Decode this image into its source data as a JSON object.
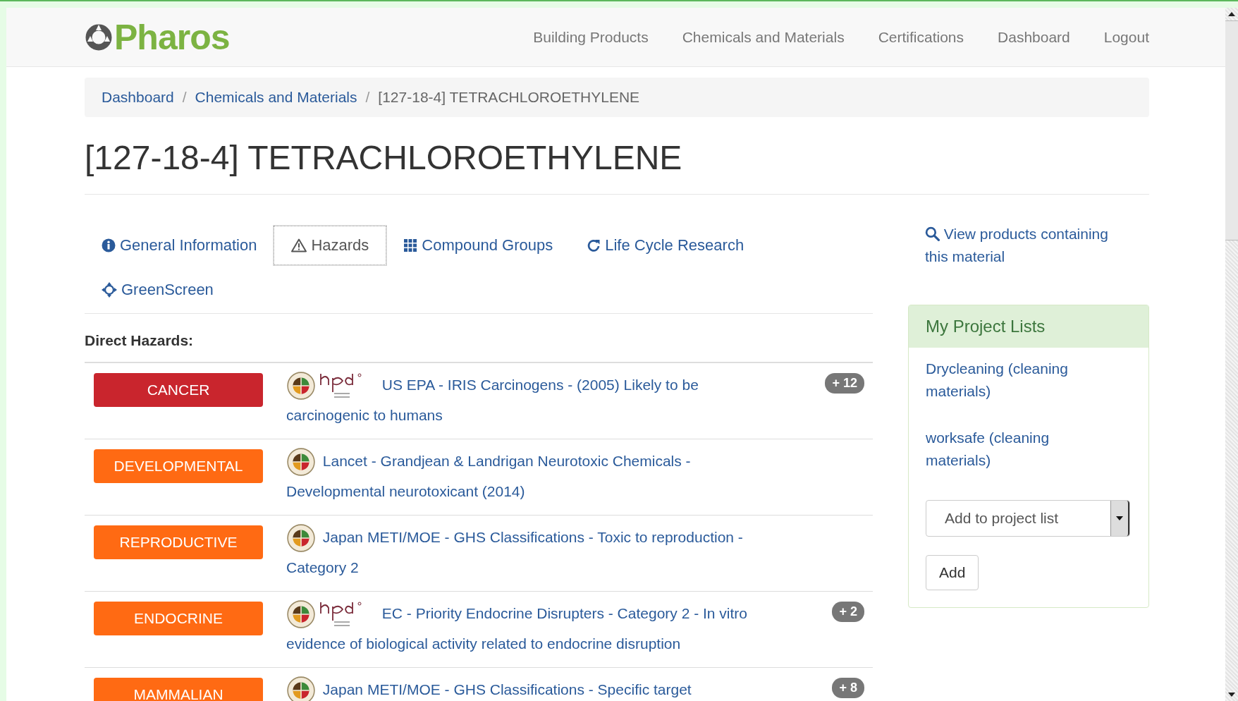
{
  "brand": "Pharos",
  "nav": [
    "Building Products",
    "Chemicals and Materials",
    "Certifications",
    "Dashboard",
    "Logout"
  ],
  "breadcrumb": [
    "Dashboard",
    "/",
    "Chemicals and Materials",
    "/",
    "[127-18-4] TETRACHLOROETHYLENE"
  ],
  "title": "[127-18-4] TETRACHLOROETHYLENE",
  "tabs": [
    {
      "label": "General Information",
      "selected": false
    },
    {
      "label": "Hazards",
      "selected": true
    },
    {
      "label": "Compound Groups",
      "selected": false
    },
    {
      "label": "Life Cycle Research",
      "selected": false
    },
    {
      "label": "GreenScreen",
      "selected": false
    }
  ],
  "view_products_link": "View products containing this material",
  "section_heading": "Direct Hazards:",
  "hazards": [
    {
      "label": "CANCER",
      "color": "#c9252d",
      "hpd_logo": true,
      "text": "US EPA - IRIS Carcinogens - (2005) Likely to be carcinogenic to humans",
      "count": "+ 12"
    },
    {
      "label": "DEVELOPMENTAL",
      "color": "#ff6a13",
      "hpd_logo": false,
      "text": "Lancet - Grandjean & Landrigan Neurotoxic Chemicals - Developmental neurotoxicant (2014)"
    },
    {
      "label": "REPRODUCTIVE",
      "color": "#ff6a13",
      "hpd_logo": false,
      "text": "Japan METI/MOE - GHS Classifications - Toxic to reproduction - Category 2"
    },
    {
      "label": "ENDOCRINE",
      "color": "#ff6a13",
      "hpd_logo": true,
      "text": "EC - Priority Endocrine Disrupters - Category 2 - In vitro evidence of biological activity related to endocrine disruption",
      "count": "+ 2"
    },
    {
      "label": "MAMMALIAN",
      "color": "#ff6a13",
      "hpd_logo": false,
      "text": "Japan METI/MOE - GHS Classifications - Specific target",
      "count": "+ 8"
    }
  ],
  "project_lists": {
    "heading": "My Project Lists",
    "items": [
      "Drycleaning (cleaning materials)",
      "worksafe (cleaning materials)"
    ],
    "select_value": "Add to project list",
    "add_button": "Add"
  }
}
